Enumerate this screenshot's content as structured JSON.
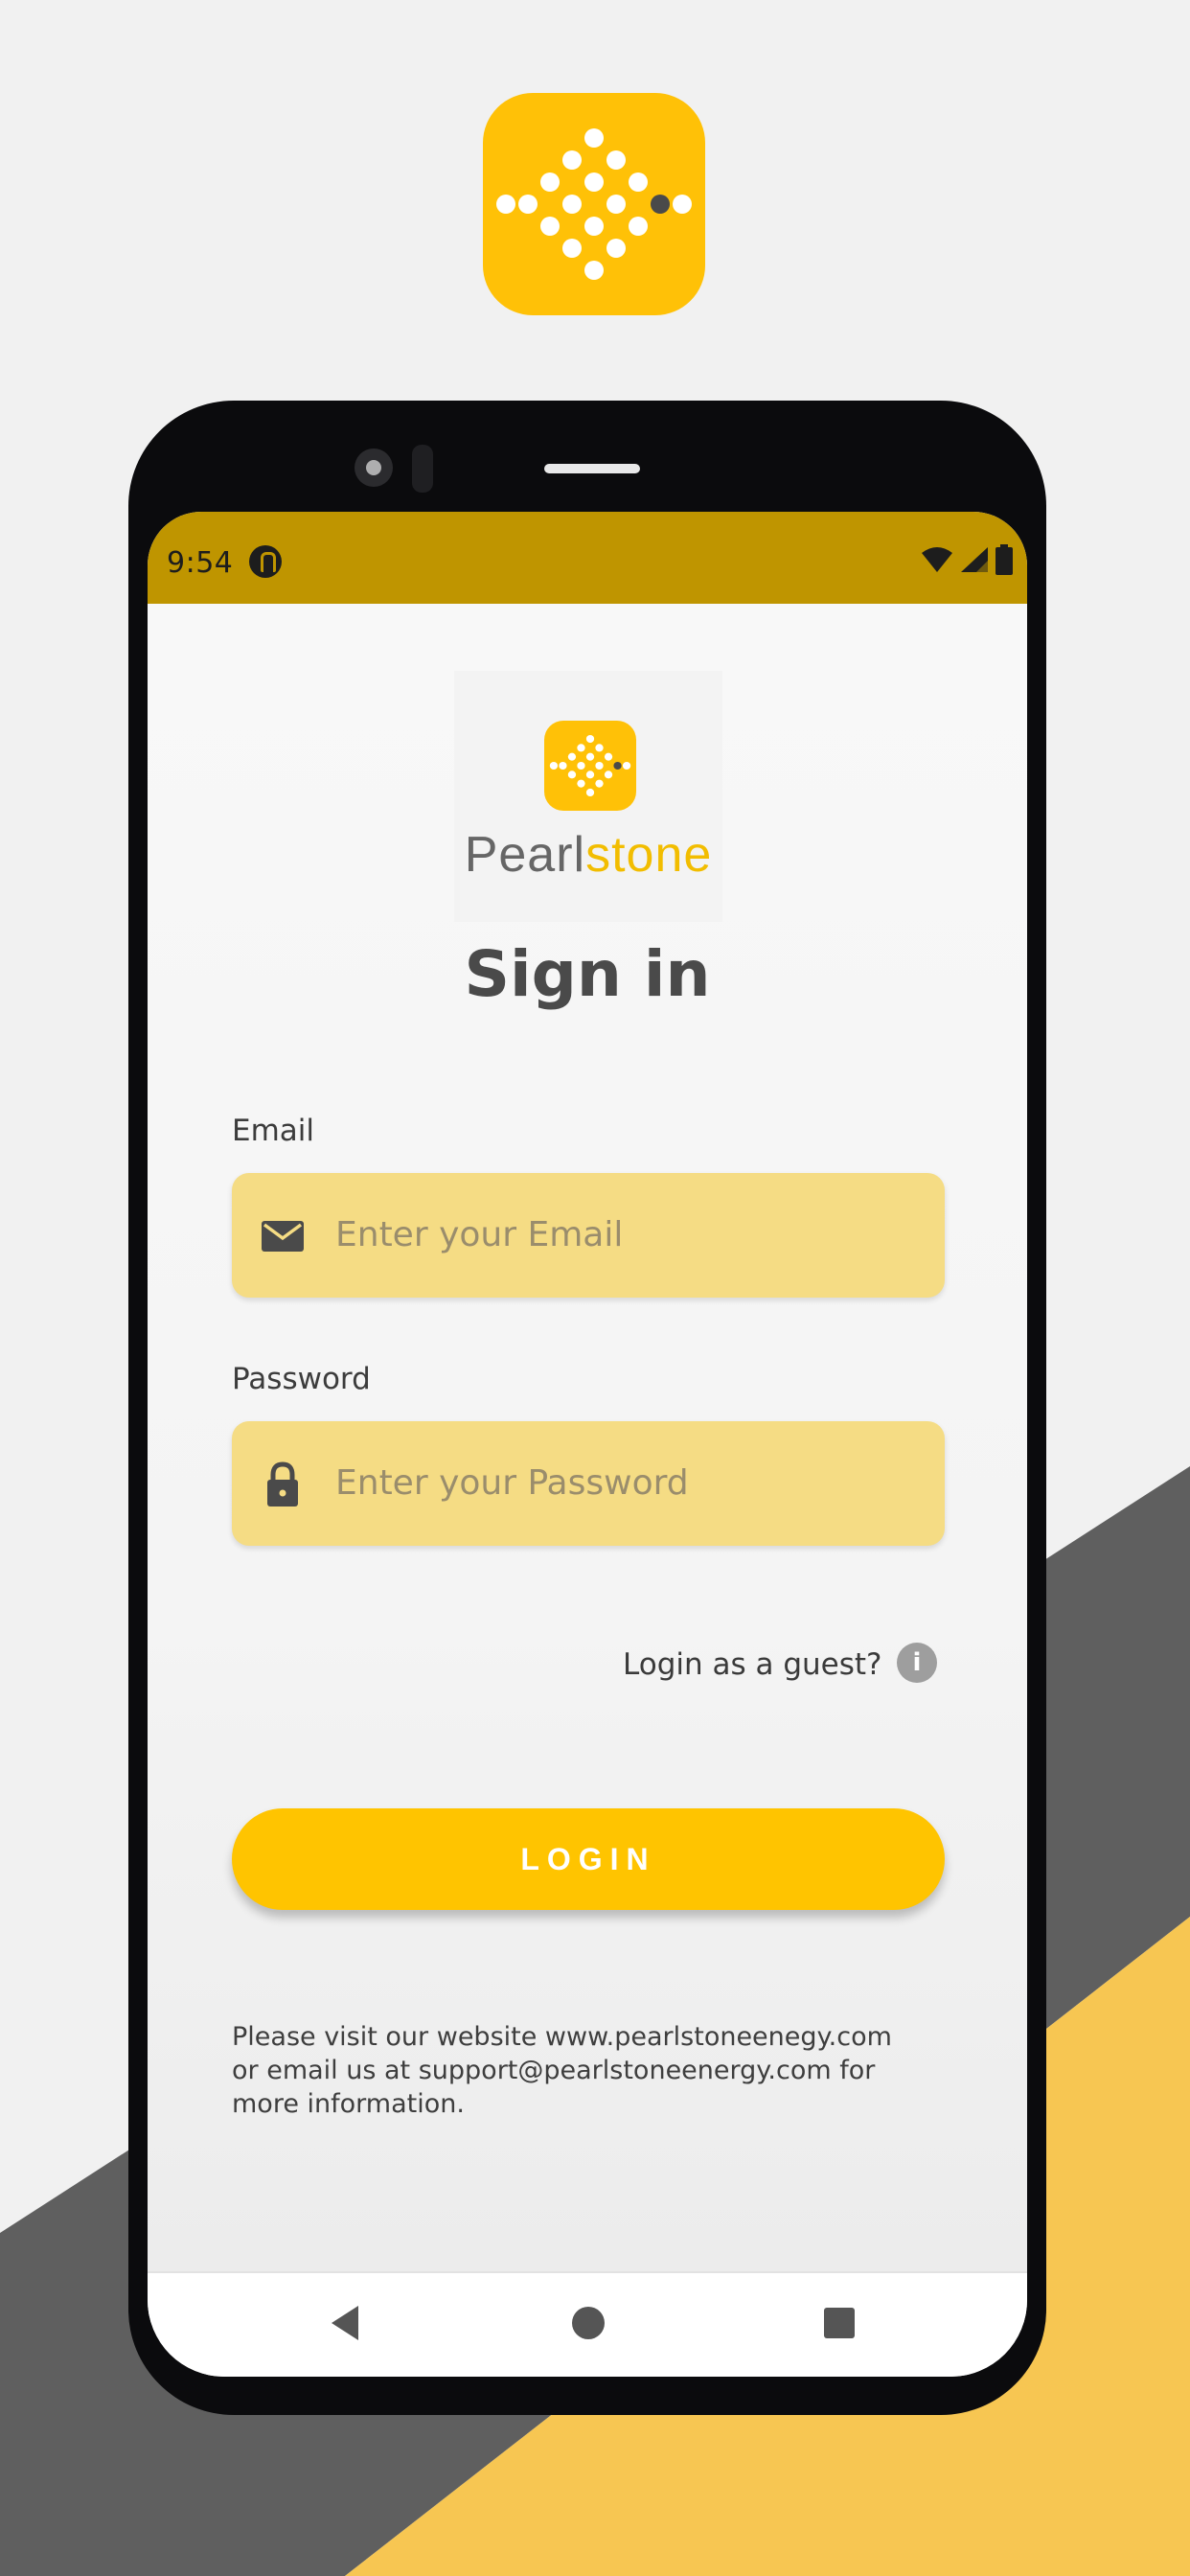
{
  "status_bar": {
    "time": "9:54"
  },
  "app": {
    "brand_name_part1": "Pearl",
    "brand_name_part2": "stone"
  },
  "login": {
    "title": "Sign in",
    "email_label": "Email",
    "email_placeholder": "Enter your Email",
    "password_label": "Password",
    "password_placeholder": "Enter your Password",
    "guest_link": "Login as a guest?",
    "info_glyph": "i",
    "login_button": "LOGIN",
    "footer_text": "Please visit our website www.pearlstoneenegy.com or email us at support@pearlstoneenergy.com for more information."
  },
  "colors": {
    "brand_yellow": "#ffc107",
    "status_bar": "#bf9500",
    "field_background": "#f5dc84",
    "button": "#ffc400",
    "stripe_dark": "#5f5f5f",
    "stripe_yellow": "#f7c652"
  },
  "icons": [
    "app-logo-icon",
    "email-icon",
    "lock-icon",
    "info-icon",
    "wifi-icon",
    "signal-icon",
    "battery-icon",
    "nav-back-icon",
    "nav-home-icon",
    "nav-recents-icon"
  ]
}
